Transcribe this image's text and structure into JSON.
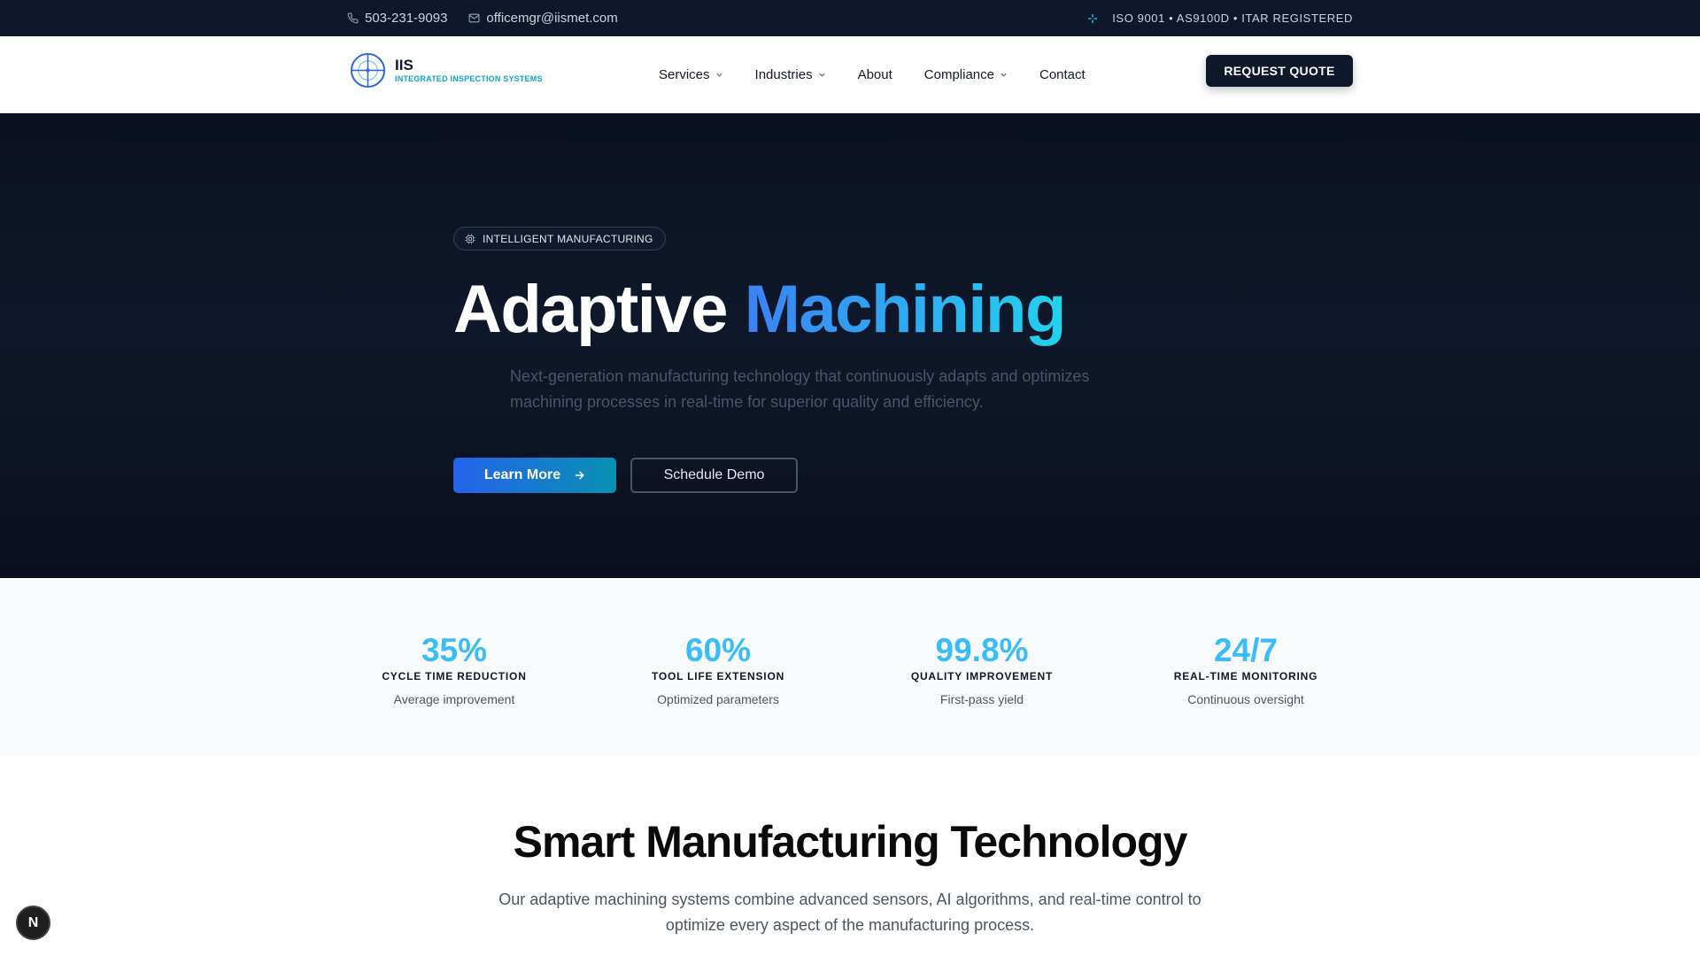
{
  "topbar": {
    "phone": "503-231-9093",
    "email": "officemgr@iismet.com",
    "certifications": "ISO 9001 • AS9100D • ITAR REGISTERED"
  },
  "nav": {
    "logo_title": "IIS",
    "logo_subtitle": "INTEGRATED INSPECTION SYSTEMS",
    "items": [
      {
        "label": "Services"
      },
      {
        "label": "Industries"
      },
      {
        "label": "About"
      },
      {
        "label": "Compliance"
      },
      {
        "label": "Contact"
      }
    ],
    "cta": "REQUEST QUOTE"
  },
  "hero": {
    "badge": "INTELLIGENT MANUFACTURING",
    "title_main": "Adaptive",
    "title_accent": "Machining",
    "subtitle": "Next-generation manufacturing technology that continuously adapts and optimizes machining processes in real-time for superior quality and efficiency.",
    "primary_button": "Learn More",
    "secondary_button": "Schedule Demo"
  },
  "stats": [
    {
      "value": "35%",
      "label": "CYCLE TIME REDUCTION",
      "desc": "Average improvement"
    },
    {
      "value": "60%",
      "label": "TOOL LIFE EXTENSION",
      "desc": "Optimized parameters"
    },
    {
      "value": "99.8%",
      "label": "QUALITY IMPROVEMENT",
      "desc": "First-pass yield"
    },
    {
      "value": "24/7",
      "label": "REAL-TIME MONITORING",
      "desc": "Continuous oversight"
    }
  ],
  "section": {
    "title": "Smart Manufacturing Technology",
    "subtitle": "Our adaptive machining systems combine advanced sensors, AI algorithms, and real-time control to optimize every aspect of the manufacturing process."
  },
  "fab_label": "N",
  "colors": {
    "accent": "#38bdf8",
    "dark": "#0f172a",
    "primary_gradient_start": "#2563eb",
    "primary_gradient_end": "#0891b2"
  }
}
